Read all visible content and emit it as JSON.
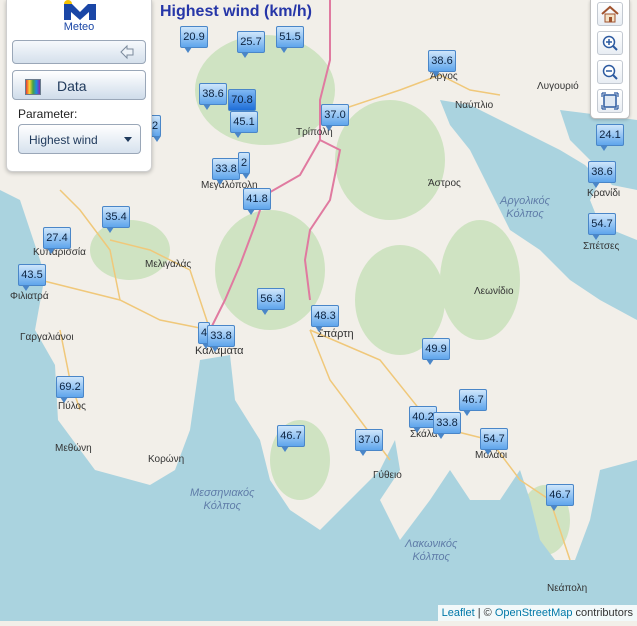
{
  "panel": {
    "logo_text": "Meteo",
    "data_label": "Data",
    "parameter_label": "Parameter:",
    "parameter_value": "Highest wind"
  },
  "map": {
    "title": "Highest wind (km/h)",
    "stations": [
      {
        "value": "20.9"
      },
      {
        "value": "25.7"
      },
      {
        "value": "51.5"
      },
      {
        "value": "38.6"
      },
      {
        "value": "38.6"
      },
      {
        "value": "70.8"
      },
      {
        "value": "45.1"
      },
      {
        "value": "2"
      },
      {
        "value": "37.0"
      },
      {
        "value": "24.1"
      },
      {
        "value": "33.8"
      },
      {
        "value": "2"
      },
      {
        "value": "38.6"
      },
      {
        "value": "41.8"
      },
      {
        "value": "35.4"
      },
      {
        "value": "54.7"
      },
      {
        "value": "27.4"
      },
      {
        "value": "43.5"
      },
      {
        "value": "56.3"
      },
      {
        "value": "48.3"
      },
      {
        "value": "4"
      },
      {
        "value": "33.8"
      },
      {
        "value": "49.9"
      },
      {
        "value": "69.2"
      },
      {
        "value": "46.7"
      },
      {
        "value": "40.2"
      },
      {
        "value": "33.8"
      },
      {
        "value": "54.7"
      },
      {
        "value": "46.7"
      },
      {
        "value": "37.0"
      },
      {
        "value": "46.7"
      }
    ],
    "places": [
      {
        "name": "Άργος"
      },
      {
        "name": "Ναύπλιο"
      },
      {
        "name": "Λυγουριό"
      },
      {
        "name": "Τρίπολη"
      },
      {
        "name": "Μεγαλόπολη"
      },
      {
        "name": "Άστρος"
      },
      {
        "name": "Κρανίδι"
      },
      {
        "name": "Σπέτσες"
      },
      {
        "name": "Κυπαρισσία"
      },
      {
        "name": "Μελιγαλάς"
      },
      {
        "name": "Φιλιατρά"
      },
      {
        "name": "Λεωνίδιο"
      },
      {
        "name": "Γαργαλιάνοι"
      },
      {
        "name": "Καλαμάτα"
      },
      {
        "name": "Σπάρτη"
      },
      {
        "name": "Πύλος"
      },
      {
        "name": "Σκάλα"
      },
      {
        "name": "Μεθώνη"
      },
      {
        "name": "Μολάοι"
      },
      {
        "name": "Κορώνη"
      },
      {
        "name": "Γύθειο"
      },
      {
        "name": "Νεάπολη"
      }
    ],
    "seas": [
      {
        "line1": "Αργολικός",
        "line2": "Κόλπος"
      },
      {
        "line1": "Μεσσηνιακός",
        "line2": "Κόλπος"
      },
      {
        "line1": "Λακωνικός",
        "line2": "Κόλπος"
      }
    ]
  },
  "toolbar": {
    "icons": [
      "home-icon",
      "zoom-in-icon",
      "zoom-out-icon",
      "fullscreen-icon"
    ]
  },
  "attribution": {
    "leaflet": "Leaflet",
    "separator": " | © ",
    "osm": "OpenStreetMap",
    "suffix": " contributors"
  },
  "colors": {
    "sea": "#aad3df",
    "land": "#f2efe9",
    "forest": "#add19e",
    "marker": "#5fa5ec",
    "title": "#2636a8"
  }
}
